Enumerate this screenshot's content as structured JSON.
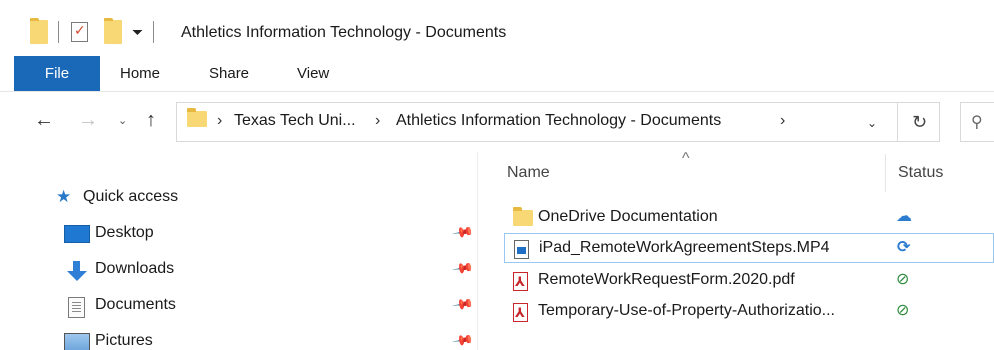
{
  "window": {
    "title": "Athletics Information Technology - Documents"
  },
  "qat": {
    "dropdown_glyph": "⏷"
  },
  "ribbon": {
    "tabs": [
      "File",
      "Home",
      "Share",
      "View"
    ]
  },
  "address": {
    "crumb_sep": "›",
    "crumbs": [
      "Texas Tech Uni...",
      "Athletics Information Technology - Documents"
    ],
    "dropdown_glyph": "⌄",
    "refresh_glyph": "↻",
    "search_glyph": "⚲"
  },
  "nav_buttons": {
    "back": "←",
    "forward": "→",
    "recent": "⌄",
    "up": "↑"
  },
  "nav_pane": {
    "quick_access": "Quick access",
    "star_glyph": "★",
    "pin_glyph": "📌",
    "items": [
      {
        "label": "Desktop",
        "icon": "desktop-icon"
      },
      {
        "label": "Downloads",
        "icon": "downloads-icon"
      },
      {
        "label": "Documents",
        "icon": "documents-icon"
      },
      {
        "label": "Pictures",
        "icon": "pictures-icon"
      }
    ]
  },
  "file_list": {
    "sort_glyph": "^",
    "columns": {
      "name": "Name",
      "status": "Status"
    },
    "rows": [
      {
        "name": "OneDrive Documentation",
        "icon": "folder-icon",
        "status_glyph": "☁",
        "status": "cloud"
      },
      {
        "name": "iPad_RemoteWorkAgreementSteps.MP4",
        "icon": "video-file-icon",
        "status_glyph": "⟳",
        "status": "syncing"
      },
      {
        "name": "RemoteWorkRequestForm.2020.pdf",
        "icon": "pdf-file-icon",
        "status_glyph": "⊘",
        "status": "available"
      },
      {
        "name": "Temporary-Use-of-Property-Authorizatio...",
        "icon": "pdf-file-icon",
        "status_glyph": "⊘",
        "status": "available"
      }
    ]
  },
  "colors": {
    "accent": "#1a68b8",
    "folder": "#f8d775",
    "sync_blue": "#2b7bcf",
    "ok_green": "#2e8b3e",
    "pdf_red": "#c8272e"
  }
}
